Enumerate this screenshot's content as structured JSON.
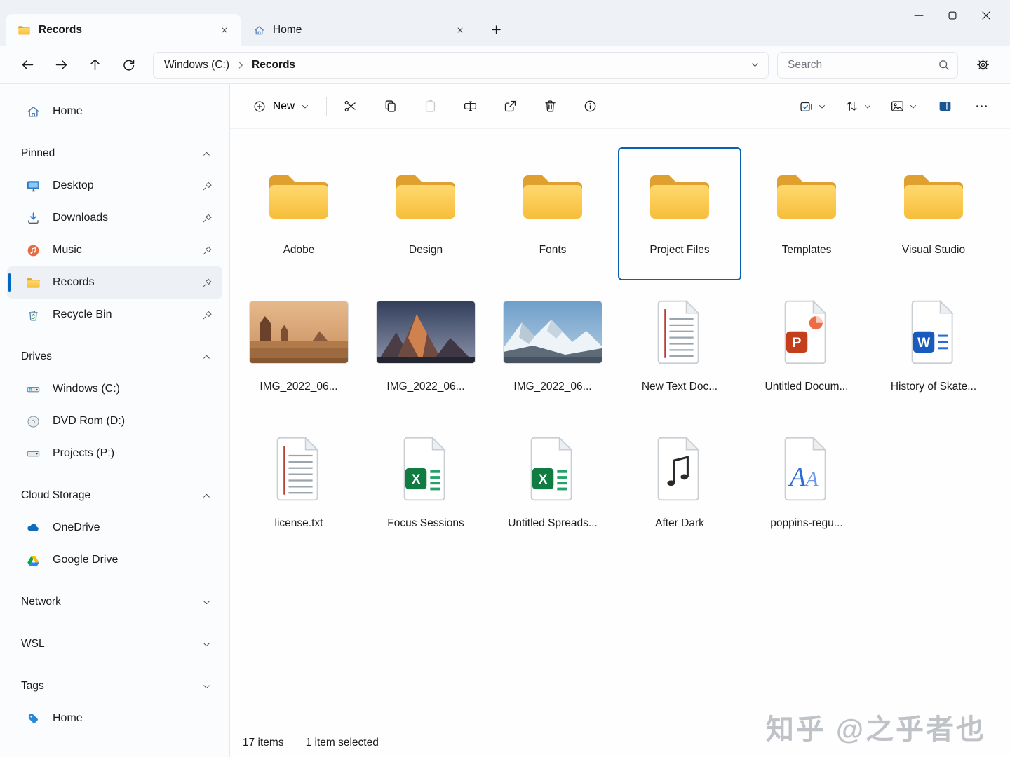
{
  "window": {
    "tabs": [
      {
        "label": "Records",
        "icon": "folder",
        "active": true
      },
      {
        "label": "Home",
        "icon": "home",
        "active": false
      }
    ]
  },
  "navbar": {
    "breadcrumb": {
      "drive": "Windows (C:)",
      "folder": "Records"
    },
    "search_placeholder": "Search"
  },
  "commandbar": {
    "new_label": "New",
    "left_icons": [
      "cut",
      "copy",
      "paste",
      "rename",
      "share",
      "delete",
      "info"
    ],
    "right_icons": [
      {
        "name": "select-all",
        "chevron": true
      },
      {
        "name": "sort",
        "chevron": true
      },
      {
        "name": "view",
        "chevron": true
      },
      {
        "name": "details-pane",
        "chevron": false
      },
      {
        "name": "more",
        "chevron": false
      }
    ]
  },
  "sidebar": {
    "items_top": [
      {
        "label": "Home",
        "icon": "home"
      }
    ],
    "sections": [
      {
        "label": "Pinned",
        "chevron": "up",
        "items": [
          {
            "label": "Desktop",
            "icon": "desktop",
            "pin": true
          },
          {
            "label": "Downloads",
            "icon": "downloads",
            "pin": true
          },
          {
            "label": "Music",
            "icon": "music",
            "pin": true
          },
          {
            "label": "Records",
            "icon": "folder",
            "pin": true,
            "selected": true
          },
          {
            "label": "Recycle Bin",
            "icon": "recycle",
            "pin": true
          }
        ]
      },
      {
        "label": "Drives",
        "chevron": "up",
        "items": [
          {
            "label": "Windows (C:)",
            "icon": "drive-windows"
          },
          {
            "label": "DVD Rom (D:)",
            "icon": "dvd"
          },
          {
            "label": "Projects (P:)",
            "icon": "drive"
          }
        ]
      },
      {
        "label": "Cloud Storage",
        "chevron": "up",
        "items": [
          {
            "label": "OneDrive",
            "icon": "onedrive"
          },
          {
            "label": "Google Drive",
            "icon": "google-drive"
          }
        ]
      },
      {
        "label": "Network",
        "chevron": "down",
        "items": []
      },
      {
        "label": "WSL",
        "chevron": "down",
        "items": []
      },
      {
        "label": "Tags",
        "chevron": "down",
        "items": [
          {
            "label": "Home",
            "icon": "tag"
          }
        ]
      }
    ]
  },
  "content": {
    "items": [
      {
        "label": "Adobe",
        "icon": "folder"
      },
      {
        "label": "Design",
        "icon": "folder"
      },
      {
        "label": "Fonts",
        "icon": "folder"
      },
      {
        "label": "Project Files",
        "icon": "folder",
        "selected": true
      },
      {
        "label": "Templates",
        "icon": "folder"
      },
      {
        "label": "Visual Studio",
        "icon": "folder"
      },
      {
        "label": "IMG_2022_06...",
        "icon": "image-desert"
      },
      {
        "label": "IMG_2022_06...",
        "icon": "image-sunset"
      },
      {
        "label": "IMG_2022_06...",
        "icon": "image-snow"
      },
      {
        "label": "New Text Doc...",
        "icon": "text-file"
      },
      {
        "label": "Untitled Docum...",
        "icon": "powerpoint-file"
      },
      {
        "label": "History of Skate...",
        "icon": "word-file"
      },
      {
        "label": "license.txt",
        "icon": "text-file"
      },
      {
        "label": "Focus Sessions",
        "icon": "excel-file"
      },
      {
        "label": "Untitled Spreads...",
        "icon": "excel-file"
      },
      {
        "label": "After Dark",
        "icon": "audio-file"
      },
      {
        "label": "poppins-regu...",
        "icon": "font-file"
      }
    ]
  },
  "statusbar": {
    "count": "17 items",
    "selected": "1 item selected"
  },
  "watermark": "知乎 @之乎者也"
}
